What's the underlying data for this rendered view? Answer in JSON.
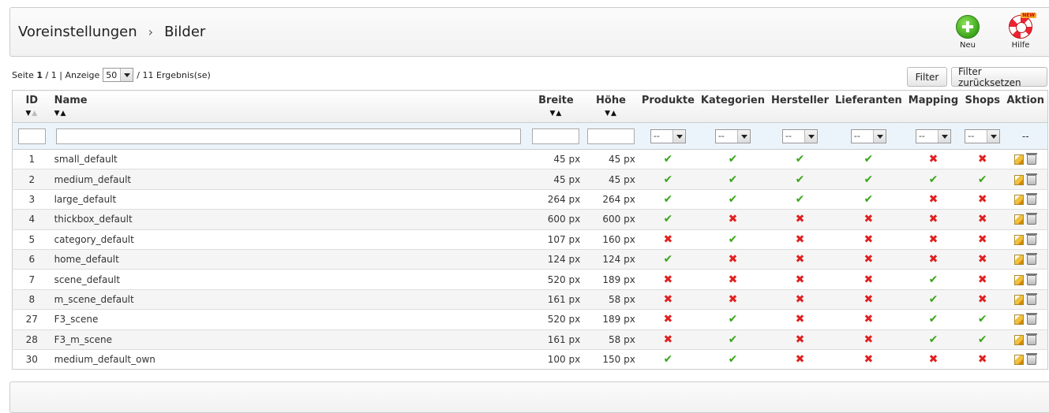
{
  "toolbar": {
    "crumb_1": "Voreinstellungen",
    "crumb_sep": "›",
    "crumb_2": "Bilder",
    "new_label": "Neu",
    "help_label": "Hilfe",
    "new_tag": "NEW"
  },
  "pager": {
    "page_prefix": "Seite",
    "page_current": "1",
    "page_total_text": "/ 1 | Anzeige",
    "per_page": "50",
    "results": "/ 11 Ergebnis(se)"
  },
  "buttons": {
    "filter": "Filter",
    "reset": "Filter zurücksetzen"
  },
  "columns": {
    "id": "ID",
    "name": "Name",
    "width": "Breite",
    "height": "Höhe",
    "products": "Produkte",
    "categories": "Kategorien",
    "manufacturers": "Hersteller",
    "suppliers": "Lieferanten",
    "mapping": "Mapping",
    "shops": "Shops",
    "action": "Aktion"
  },
  "filters": {
    "select_value": "--",
    "action_value": "--"
  },
  "rows": [
    {
      "id": "1",
      "name": "small_default",
      "w": "45 px",
      "h": "45 px",
      "flags": [
        1,
        1,
        1,
        1,
        0,
        0
      ]
    },
    {
      "id": "2",
      "name": "medium_default",
      "w": "45 px",
      "h": "45 px",
      "flags": [
        1,
        1,
        1,
        1,
        1,
        1
      ]
    },
    {
      "id": "3",
      "name": "large_default",
      "w": "264 px",
      "h": "264 px",
      "flags": [
        1,
        1,
        1,
        1,
        0,
        0
      ]
    },
    {
      "id": "4",
      "name": "thickbox_default",
      "w": "600 px",
      "h": "600 px",
      "flags": [
        1,
        0,
        0,
        0,
        0,
        0
      ]
    },
    {
      "id": "5",
      "name": "category_default",
      "w": "107 px",
      "h": "160 px",
      "flags": [
        0,
        1,
        0,
        0,
        0,
        0
      ]
    },
    {
      "id": "6",
      "name": "home_default",
      "w": "124 px",
      "h": "124 px",
      "flags": [
        1,
        0,
        0,
        0,
        0,
        0
      ]
    },
    {
      "id": "7",
      "name": "scene_default",
      "w": "520 px",
      "h": "189 px",
      "flags": [
        0,
        0,
        0,
        0,
        1,
        0
      ]
    },
    {
      "id": "8",
      "name": "m_scene_default",
      "w": "161 px",
      "h": "58 px",
      "flags": [
        0,
        0,
        0,
        0,
        1,
        0
      ]
    },
    {
      "id": "27",
      "name": "F3_scene",
      "w": "520 px",
      "h": "189 px",
      "flags": [
        0,
        1,
        0,
        0,
        1,
        1
      ]
    },
    {
      "id": "28",
      "name": "F3_m_scene",
      "w": "161 px",
      "h": "58 px",
      "flags": [
        0,
        1,
        0,
        0,
        1,
        1
      ]
    },
    {
      "id": "30",
      "name": "medium_default_own",
      "w": "100 px",
      "h": "150 px",
      "flags": [
        1,
        1,
        0,
        0,
        0,
        0
      ]
    }
  ],
  "icons": {
    "yes": "✔",
    "no": "✖",
    "sort_desc": "▼",
    "sort_asc": "▲"
  },
  "colors": {
    "yes": "#3aa51a",
    "no": "#e02020",
    "filter_row": "#ecf4fb"
  }
}
